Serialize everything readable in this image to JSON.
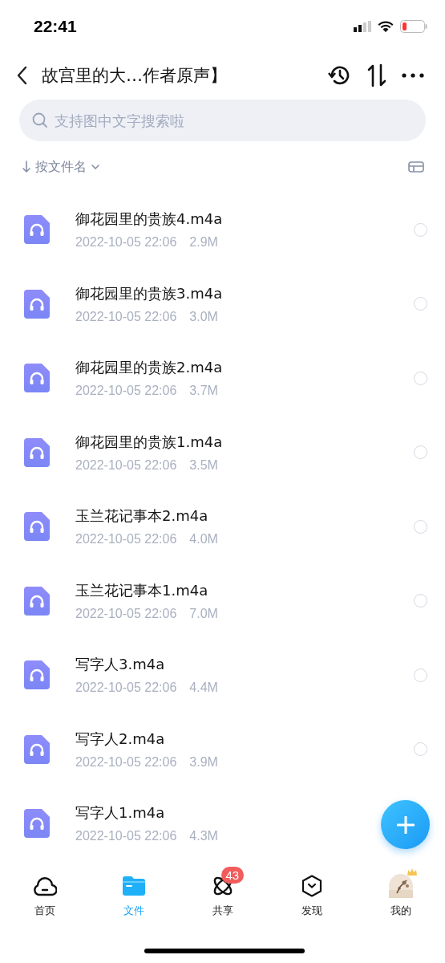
{
  "status_bar": {
    "time": "22:41"
  },
  "header": {
    "title": "故宫里的大…作者原声】"
  },
  "search": {
    "placeholder": "支持图中文字搜索啦"
  },
  "sort": {
    "label": "按文件名"
  },
  "files": [
    {
      "name": "御花园里的贵族4.m4a",
      "date": "2022-10-05 22:06",
      "size": "2.9M",
      "selected": false
    },
    {
      "name": "御花园里的贵族3.m4a",
      "date": "2022-10-05 22:06",
      "size": "3.0M",
      "selected": false
    },
    {
      "name": "御花园里的贵族2.m4a",
      "date": "2022-10-05 22:06",
      "size": "3.7M",
      "selected": false
    },
    {
      "name": "御花园里的贵族1.m4a",
      "date": "2022-10-05 22:06",
      "size": "3.5M",
      "selected": false
    },
    {
      "name": "玉兰花记事本2.m4a",
      "date": "2022-10-05 22:06",
      "size": "4.0M",
      "selected": false
    },
    {
      "name": "玉兰花记事本1.m4a",
      "date": "2022-10-05 22:06",
      "size": "7.0M",
      "selected": false
    },
    {
      "name": "写字人3.m4a",
      "date": "2022-10-05 22:06",
      "size": "4.4M",
      "selected": false
    },
    {
      "name": "写字人2.m4a",
      "date": "2022-10-05 22:06",
      "size": "3.9M",
      "selected": false
    },
    {
      "name": "写字人1.m4a",
      "date": "2022-10-05 22:06",
      "size": "4.3M"
    }
  ],
  "tabs": [
    {
      "kind": "home",
      "label": "首页",
      "selected": false
    },
    {
      "kind": "files",
      "label": "文件",
      "selected": true
    },
    {
      "kind": "share",
      "label": "共享",
      "selected": false,
      "badge": "43"
    },
    {
      "kind": "discover",
      "label": "发现",
      "selected": false
    },
    {
      "kind": "me",
      "label": "我的",
      "selected": false
    }
  ]
}
